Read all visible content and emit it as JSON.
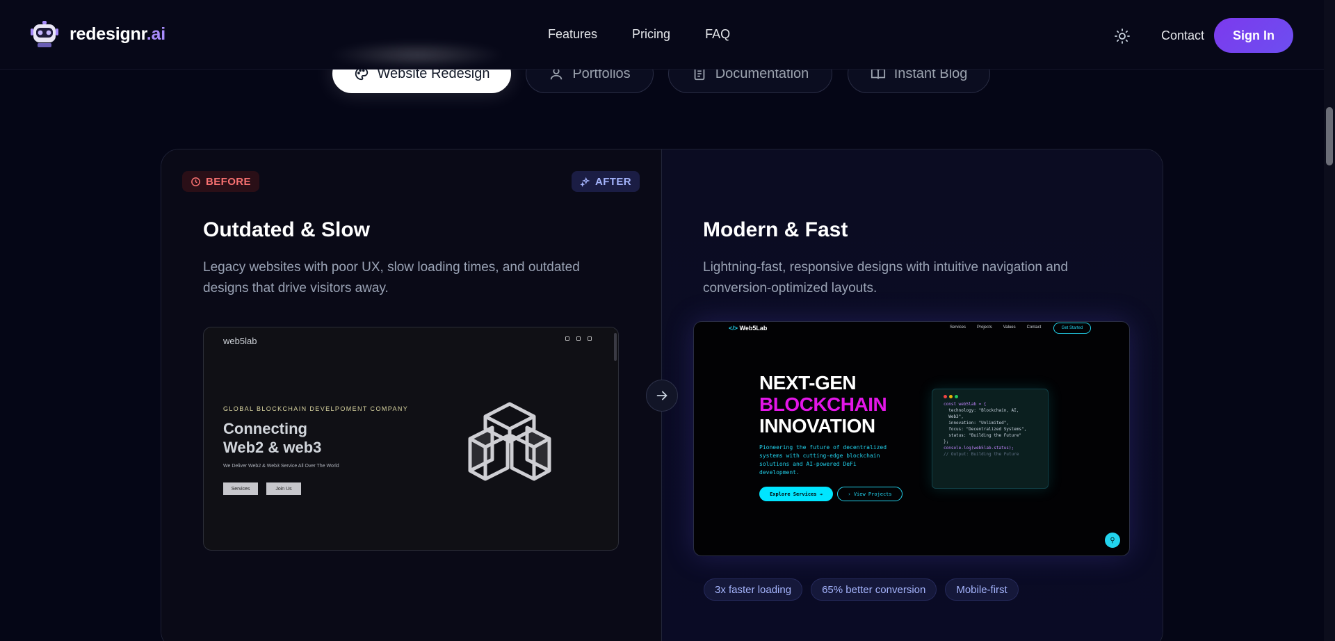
{
  "brand": {
    "name_main": "redesignr",
    "name_accent": ".ai"
  },
  "nav": {
    "links": [
      "Features",
      "Pricing",
      "FAQ"
    ],
    "contact": "Contact",
    "signin": "Sign In"
  },
  "tabs": [
    {
      "label": "Website Redesign",
      "icon": "palette-icon",
      "active": true
    },
    {
      "label": "Portfolios",
      "icon": "user-icon",
      "active": false
    },
    {
      "label": "Documentation",
      "icon": "document-icon",
      "active": false
    },
    {
      "label": "Instant Blog",
      "icon": "book-open-icon",
      "active": false
    }
  ],
  "before": {
    "badge": "BEFORE",
    "title": "Outdated & Slow",
    "description": "Legacy websites with poor UX, slow loading times, and outdated designs that drive visitors away.",
    "preview": {
      "logo": "web5lab",
      "tagline": "GLOBAL BLOCKCHAIN DEVELPOMENT COMPANY",
      "title_line1": "Connecting",
      "title_line2": "Web2 & web3",
      "subtitle": "We Deliver Web2 & Web3 Service All Over The World",
      "btn_services": "Services",
      "btn_join": "Join Us"
    }
  },
  "after": {
    "badge": "AFTER",
    "title": "Modern & Fast",
    "description": "Lightning-fast, responsive designs with intuitive navigation and conversion-optimized layouts.",
    "preview": {
      "logo": "Web5Lab",
      "nav_links": [
        "Services",
        "Projects",
        "Values",
        "Contact"
      ],
      "cta": "Get Started",
      "h1_line1": "NEXT-GEN",
      "h1_line2": "BLOCKCHAIN",
      "h1_line3": "INNOVATION",
      "description": "Pioneering the future of decentralized systems with cutting-edge blockchain solutions and AI-powered DeFi development.",
      "btn_explore": "Explore Services →",
      "btn_projects": "› View Projects",
      "code": [
        "const web5lab = {",
        "  technology: \"Blockchain, AI,",
        "  Web3\",",
        "  innovation: \"Unlimited\",",
        "  focus: \"Decentralized Systems\",",
        "  status: \"Building the Future\"",
        "};",
        "",
        "console.log(web5lab.status);",
        "",
        "// Output: Building the Future"
      ]
    },
    "chips": [
      "3x faster loading",
      "65% better conversion",
      "Mobile-first"
    ]
  },
  "colors": {
    "accent": "#7c3aed",
    "before_badge": "#f87171",
    "after_badge": "#a5b4fc",
    "magenta": "#e316e8",
    "cyan": "#22d3ee"
  }
}
